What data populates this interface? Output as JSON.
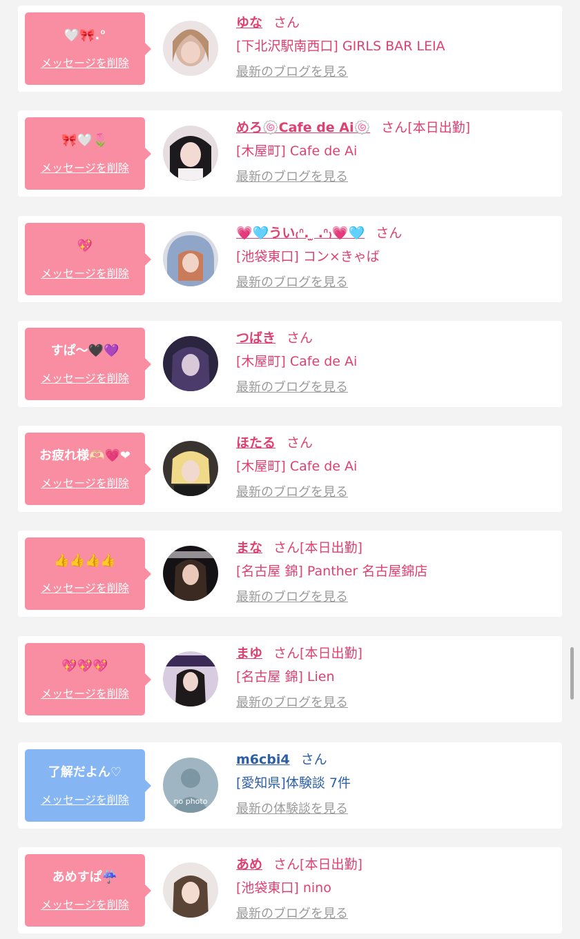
{
  "delete_label": "メッセージを削除",
  "san": "さん",
  "colors": {
    "pink_bubble": "#f98da2",
    "blue_bubble": "#86b5f3",
    "name_pink": "#e0406f",
    "name_blue": "#2c5fa8"
  },
  "messages": [
    {
      "message": "🤍🎀.°",
      "name": "ゆな",
      "status": "",
      "shop": "[下北沢駅南西口] GIRLS BAR LEIA",
      "link": "最新のブログを見る",
      "color": "pink"
    },
    {
      "message": "🎀🤍🌷",
      "name": "めろ🍥Cafe de Ai🍥",
      "status": "[本日出勤]",
      "shop": "[木屋町] Cafe de Ai",
      "link": "最新のブログを見る",
      "color": "pink"
    },
    {
      "message": "💖",
      "name": "💗🩵うい₍ᐢ. ̫ .ᐢ₎💗🩵",
      "status": "",
      "shop": "[池袋東口] コン×きゃば",
      "link": "最新のブログを見る",
      "color": "pink"
    },
    {
      "message": "すぱ〜🖤💜",
      "name": "つばき",
      "status": "",
      "shop": "[木屋町] Cafe de Ai",
      "link": "最新のブログを見る",
      "color": "pink"
    },
    {
      "message": "お疲れ様🫶🏻💗‪‪❤︎‬",
      "name": "ほたる",
      "status": "",
      "shop": "[木屋町] Cafe de Ai",
      "link": "最新のブログを見る",
      "color": "pink"
    },
    {
      "message": "👍👍👍👍",
      "name": "まな",
      "status": "[本日出勤]",
      "shop": "[名古屋 錦] Panther 名古屋錦店",
      "link": "最新のブログを見る",
      "color": "pink"
    },
    {
      "message": "💖💖💖",
      "name": "まゆ",
      "status": "[本日出勤]",
      "shop": "[名古屋 錦] Lien",
      "link": "最新のブログを見る",
      "color": "pink"
    },
    {
      "message": "了解だよん♡",
      "name": "m6cbi4",
      "status": "",
      "shop": "[愛知県]体験談 7件",
      "link": "最新の体験談を見る",
      "color": "blue",
      "avatar_text": "no photo"
    },
    {
      "message": "あめすぱ☔️",
      "name": "あめ",
      "status": "[本日出勤]",
      "shop": "[池袋東口] nino",
      "link": "最新のブログを見る",
      "color": "pink"
    }
  ]
}
